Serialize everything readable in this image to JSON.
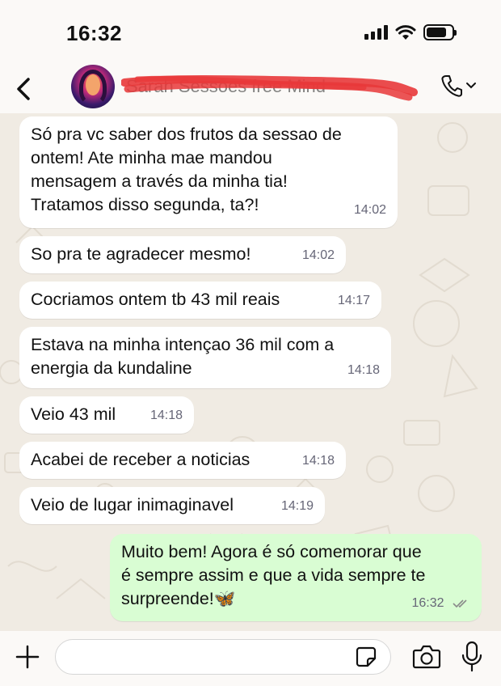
{
  "status_bar": {
    "time": "16:32"
  },
  "header": {
    "contact_name": "Sarah Sessões free Mind"
  },
  "messages": [
    {
      "direction": "in",
      "text": "Só pra vc saber dos frutos da sessao de\nontem! Ate minha mae mandou\nmensagem a través da minha tia!\nTratamos disso segunda, ta?!",
      "time": "14:02"
    },
    {
      "direction": "in",
      "text": "So pra te agradecer mesmo!",
      "time": "14:02"
    },
    {
      "direction": "in",
      "text": "Cocriamos ontem tb 43 mil reais",
      "time": "14:17"
    },
    {
      "direction": "in",
      "text": "Estava na minha intençao 36 mil com a\nenergia da kundaline",
      "time": "14:18"
    },
    {
      "direction": "in",
      "text": "Veio 43 mil",
      "time": "14:18"
    },
    {
      "direction": "in",
      "text": "Acabei de receber a noticias",
      "time": "14:18"
    },
    {
      "direction": "in",
      "text": "Veio de lugar inimaginavel",
      "time": "14:19"
    },
    {
      "direction": "out",
      "text": "Muito bem! Agora é só comemorar que\né sempre assim e que a vida sempre te\nsurpreende!🦋",
      "time": "16:32",
      "status": "read"
    }
  ],
  "input": {
    "placeholder": "",
    "value": ""
  },
  "colors": {
    "incoming_bubble": "#ffffff",
    "outgoing_bubble": "#d9fdd3",
    "chat_background": "#f0ebe3",
    "redaction": "#e8383a",
    "read_receipt": "#8a8a8a"
  },
  "icons": [
    "back-arrow-icon",
    "phone-icon",
    "chevron-down-icon",
    "plus-icon",
    "sticker-icon",
    "camera-icon",
    "microphone-icon",
    "double-check-icon",
    "signal-icon",
    "wifi-icon",
    "battery-icon"
  ]
}
